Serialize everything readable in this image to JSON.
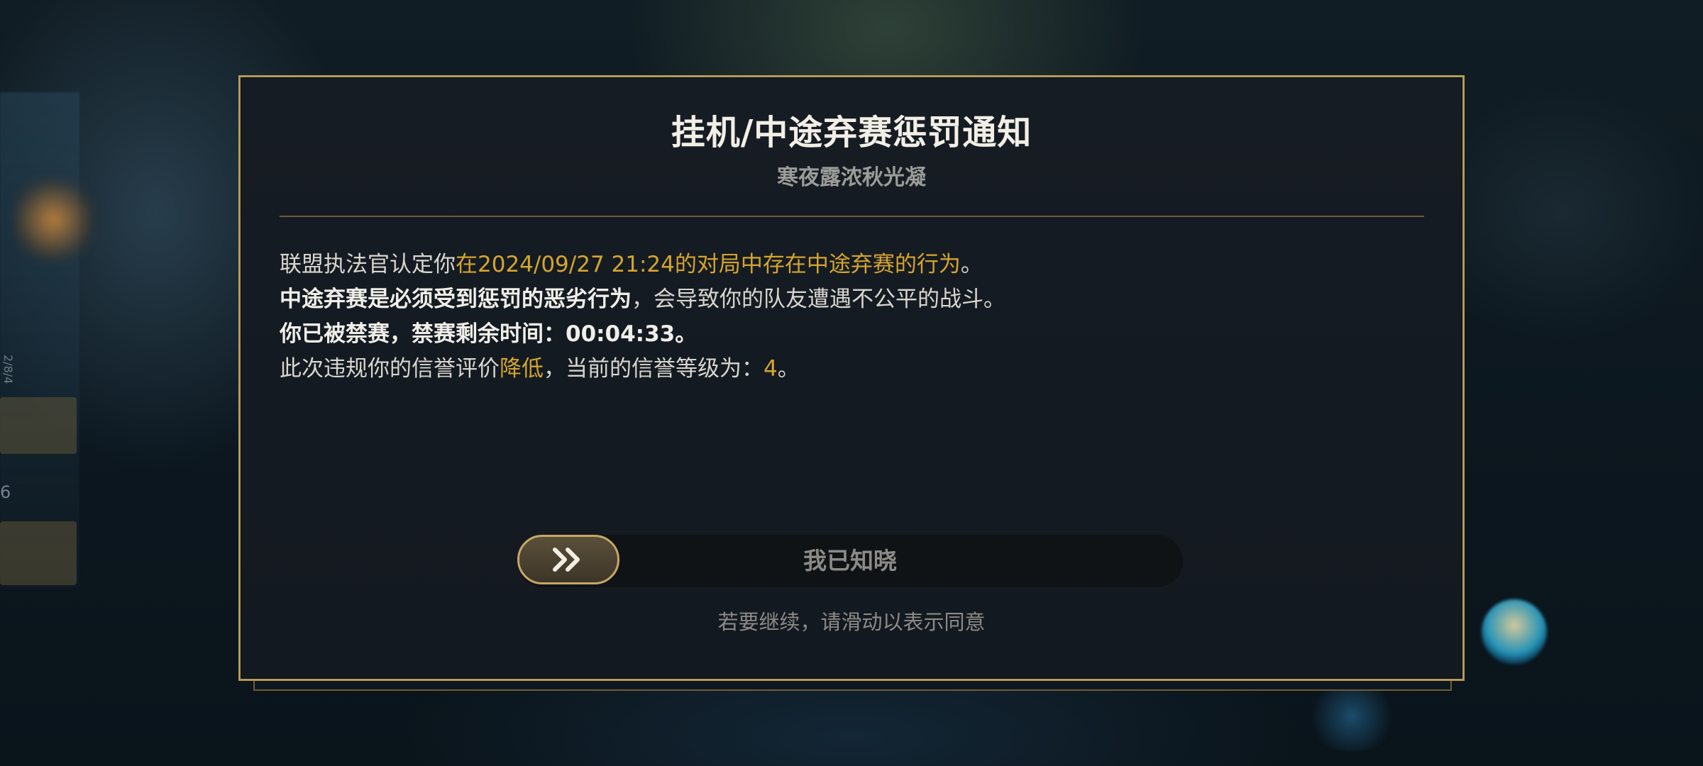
{
  "dialog": {
    "title": "挂机/中途弃赛惩罚通知",
    "subtitle": "寒夜露浓秋光凝",
    "line1": {
      "prefix": "联盟执法官认定你",
      "highlight": "在2024/09/27 21:24的对局中存在中途弃赛的行为",
      "suffix": "。"
    },
    "line2": {
      "bold": "中途弃赛是必须受到惩罚的恶劣行为",
      "rest": "，会导致你的队友遭遇不公平的战斗。"
    },
    "line3": {
      "bold": "你已被禁赛，禁赛剩余时间：00:04:33。"
    },
    "line4": {
      "prefix": "此次违规你的信誉评价",
      "highlight": "降低",
      "middle": "，当前的信誉等级为：",
      "level": "4",
      "suffix": "。"
    },
    "slider": {
      "label": "我已知晓",
      "icon": "double-chevron-right-icon"
    },
    "hint": "若要继续，请滑动以表示同意"
  },
  "background": {
    "left_vertical_text": "2/8/4",
    "left_mini_text": "6"
  },
  "colors": {
    "gold_accent": "#d5a52e",
    "border_gold": "#b59a5a",
    "dialog_bg": "#161c23"
  }
}
